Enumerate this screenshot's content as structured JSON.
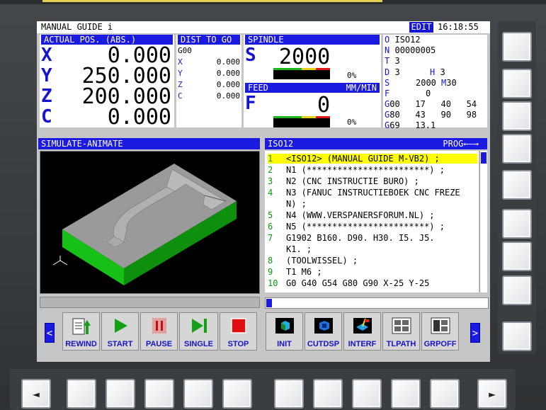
{
  "title_bar": {
    "title": "MANUAL GUIDE i",
    "mode": "EDIT",
    "time": "16:18:55"
  },
  "actual_pos": {
    "header": "ACTUAL POS. (ABS.)",
    "axes": [
      {
        "axis": "X",
        "value": "0.000"
      },
      {
        "axis": "Y",
        "value": "250.000"
      },
      {
        "axis": "Z",
        "value": "200.000"
      },
      {
        "axis": "C",
        "value": "0.000"
      }
    ]
  },
  "dist_to_go": {
    "header": "DIST TO GO",
    "code": "G00",
    "axes": [
      {
        "axis": "X",
        "value": "0.000"
      },
      {
        "axis": "Y",
        "value": "0.000"
      },
      {
        "axis": "Z",
        "value": "0.000"
      },
      {
        "axis": "C",
        "value": "0.000"
      }
    ]
  },
  "spindle": {
    "header": "SPINDLE",
    "letter": "S",
    "value": "2000",
    "percent": "0%",
    "load_fraction": 0
  },
  "feed": {
    "header": "FEED",
    "unit": "MM/MIN",
    "letter": "F",
    "value": "0",
    "percent": "0%",
    "load_fraction": 0
  },
  "modal": {
    "o": {
      "label": "O",
      "value": "ISO12"
    },
    "n": {
      "label": "N",
      "value": "00000005"
    },
    "t": {
      "label": "T",
      "value": "3"
    },
    "d": {
      "label": "D",
      "value": "3"
    },
    "h": {
      "label": "H",
      "value": "3"
    },
    "s": {
      "label": "S",
      "value": "2000"
    },
    "m": {
      "label": "M",
      "value": "30"
    },
    "f": {
      "label": "F",
      "value": "0"
    },
    "g_rows": [
      {
        "label": "G",
        "codes": "00   17   40   54"
      },
      {
        "label": "G",
        "codes": "80   43   90   98"
      },
      {
        "label": "G",
        "codes": "69   13.1"
      }
    ]
  },
  "simulate": {
    "header": "SIMULATE-ANIMATE"
  },
  "program": {
    "header": "ISO12",
    "prog_label": "PROG",
    "prog_arrows": "←—→",
    "lines": [
      {
        "num": "1",
        "text": "<ISO12> (MANUAL GUIDE M-VB2) ;",
        "selected": true
      },
      {
        "num": "2",
        "text": "N1 (************************) ;"
      },
      {
        "num": "3",
        "text": "N2 (CNC INSTRUCTIE BURO) ;"
      },
      {
        "num": "4",
        "text": "N3 (FANUC INSTRUCTIEBOEK CNC FREZE"
      },
      {
        "num": "",
        "text": "N) ;"
      },
      {
        "num": "5",
        "text": "N4 (WWW.VERSPANERSFORUM.NL) ;"
      },
      {
        "num": "6",
        "text": "N5 (************************) ;"
      },
      {
        "num": "7",
        "text": "G1902 B160. D90. H30. I5. J5."
      },
      {
        "num": "",
        "text": "K1. ;"
      },
      {
        "num": "8",
        "text": "(TOOLWISSEL) ;"
      },
      {
        "num": "9",
        "text": "T1 M6 ;"
      },
      {
        "num": "10",
        "text": "G0 G40 G54 G80 G90 X-25 Y-25"
      }
    ]
  },
  "softkeys_left": [
    {
      "label": "REWIND",
      "icon": "rewind-icon"
    },
    {
      "label": "START",
      "icon": "play-icon"
    },
    {
      "label": "PAUSE",
      "icon": "pause-icon"
    },
    {
      "label": "SINGLE",
      "icon": "single-block-icon"
    },
    {
      "label": "STOP",
      "icon": "stop-icon"
    }
  ],
  "softkeys_right": [
    {
      "label": "INIT",
      "icon": "init-icon"
    },
    {
      "label": "CUTDSP",
      "icon": "cut-display-icon"
    },
    {
      "label": "INTERF",
      "icon": "interference-icon"
    },
    {
      "label": "TLPATH",
      "icon": "tool-path-icon"
    },
    {
      "label": "GRPOFF",
      "icon": "graph-off-icon"
    }
  ],
  "nav": {
    "left_arrow": "<",
    "right_arrow": ">",
    "bottom_left_glyph": "◄",
    "bottom_right_glyph": "►"
  },
  "colors": {
    "header_blue": "#1a1ae0",
    "axis_blue": "#1515d0",
    "line_num_green": "#0a9a0a",
    "select_yellow": "#ffff00",
    "part_green": "#1bc41b"
  }
}
